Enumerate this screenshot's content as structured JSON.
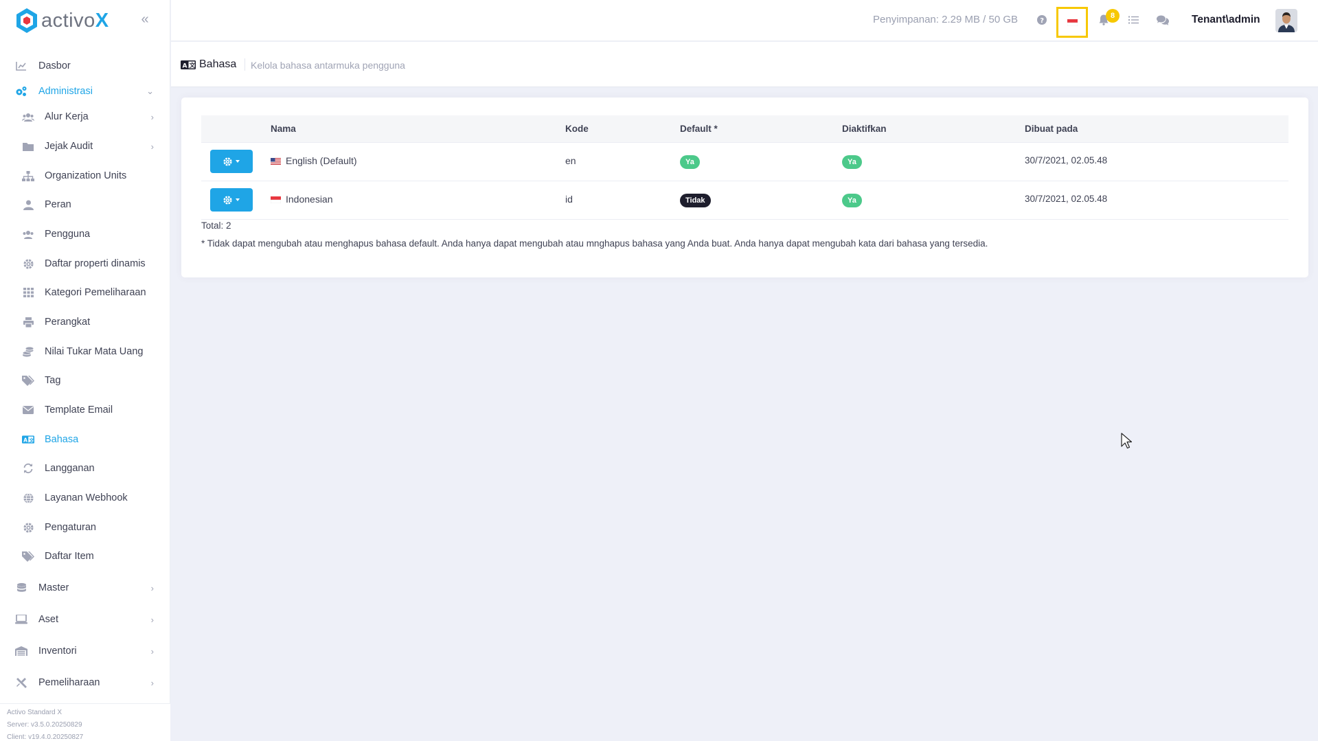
{
  "brand": {
    "name": "activo",
    "suffix": "X"
  },
  "header": {
    "storage": "Penyimpanan: 2.29 MB / 50 GB",
    "notification_count": "8",
    "user": "Tenant\\admin",
    "icons": [
      "help-icon",
      "language-flag-icon",
      "bell-icon",
      "task-list-icon",
      "chat-icon"
    ]
  },
  "sidebar": {
    "items": [
      {
        "label": "Dasbor",
        "icon": "chart-icon"
      },
      {
        "label": "Administrasi",
        "icon": "cogs-icon"
      },
      {
        "label": "Alur Kerja",
        "icon": "users-icon"
      },
      {
        "label": "Jejak Audit",
        "icon": "folder-icon"
      },
      {
        "label": "Organization Units",
        "icon": "sitemap-icon"
      },
      {
        "label": "Peran",
        "icon": "user-icon"
      },
      {
        "label": "Pengguna",
        "icon": "users-icon"
      },
      {
        "label": "Daftar properti dinamis",
        "icon": "gear-icon"
      },
      {
        "label": "Kategori Pemeliharaan",
        "icon": "grid-icon"
      },
      {
        "label": "Perangkat",
        "icon": "printer-icon"
      },
      {
        "label": "Nilai Tukar Mata Uang",
        "icon": "coins-icon"
      },
      {
        "label": "Tag",
        "icon": "tags-icon"
      },
      {
        "label": "Template Email",
        "icon": "envelope-icon"
      },
      {
        "label": "Bahasa",
        "icon": "language-icon"
      },
      {
        "label": "Langganan",
        "icon": "refresh-icon"
      },
      {
        "label": "Layanan Webhook",
        "icon": "globe-icon"
      },
      {
        "label": "Pengaturan",
        "icon": "gear-icon"
      },
      {
        "label": "Daftar Item",
        "icon": "tags-icon"
      },
      {
        "label": "Master",
        "icon": "database-icon"
      },
      {
        "label": "Aset",
        "icon": "laptop-icon"
      },
      {
        "label": "Inventori",
        "icon": "warehouse-icon"
      },
      {
        "label": "Pemeliharaan",
        "icon": "tools-icon"
      }
    ],
    "footer": {
      "product": "Activo Standard X",
      "server": "Server: v3.5.0.20250829",
      "client": "Client: v19.4.0.20250827"
    }
  },
  "page": {
    "title": "Bahasa",
    "description": "Kelola bahasa antarmuka pengguna"
  },
  "table": {
    "columns": [
      "Nama",
      "Kode",
      "Default *",
      "Diaktifkan",
      "Dibuat pada"
    ],
    "rows": [
      {
        "name": "English (Default)",
        "code": "en",
        "default": "Ya",
        "enabled": "Ya",
        "created": "30/7/2021, 02.05.48",
        "flag": "us"
      },
      {
        "name": "Indonesian",
        "code": "id",
        "default": "Tidak",
        "enabled": "Ya",
        "created": "30/7/2021, 02.05.48",
        "flag": "id"
      }
    ],
    "total": "Total: 2",
    "note": "* Tidak dapat mengubah atau menghapus bahasa default. Anda hanya dapat mengubah atau mnghapus bahasa yang Anda buat. Anda hanya dapat mengubah kata dari bahasa yang tersedia."
  },
  "colors": {
    "accent": "#1fa5e6",
    "success": "#4cc98a",
    "dark": "#1e1e2d",
    "highlight": "#f7c800"
  }
}
